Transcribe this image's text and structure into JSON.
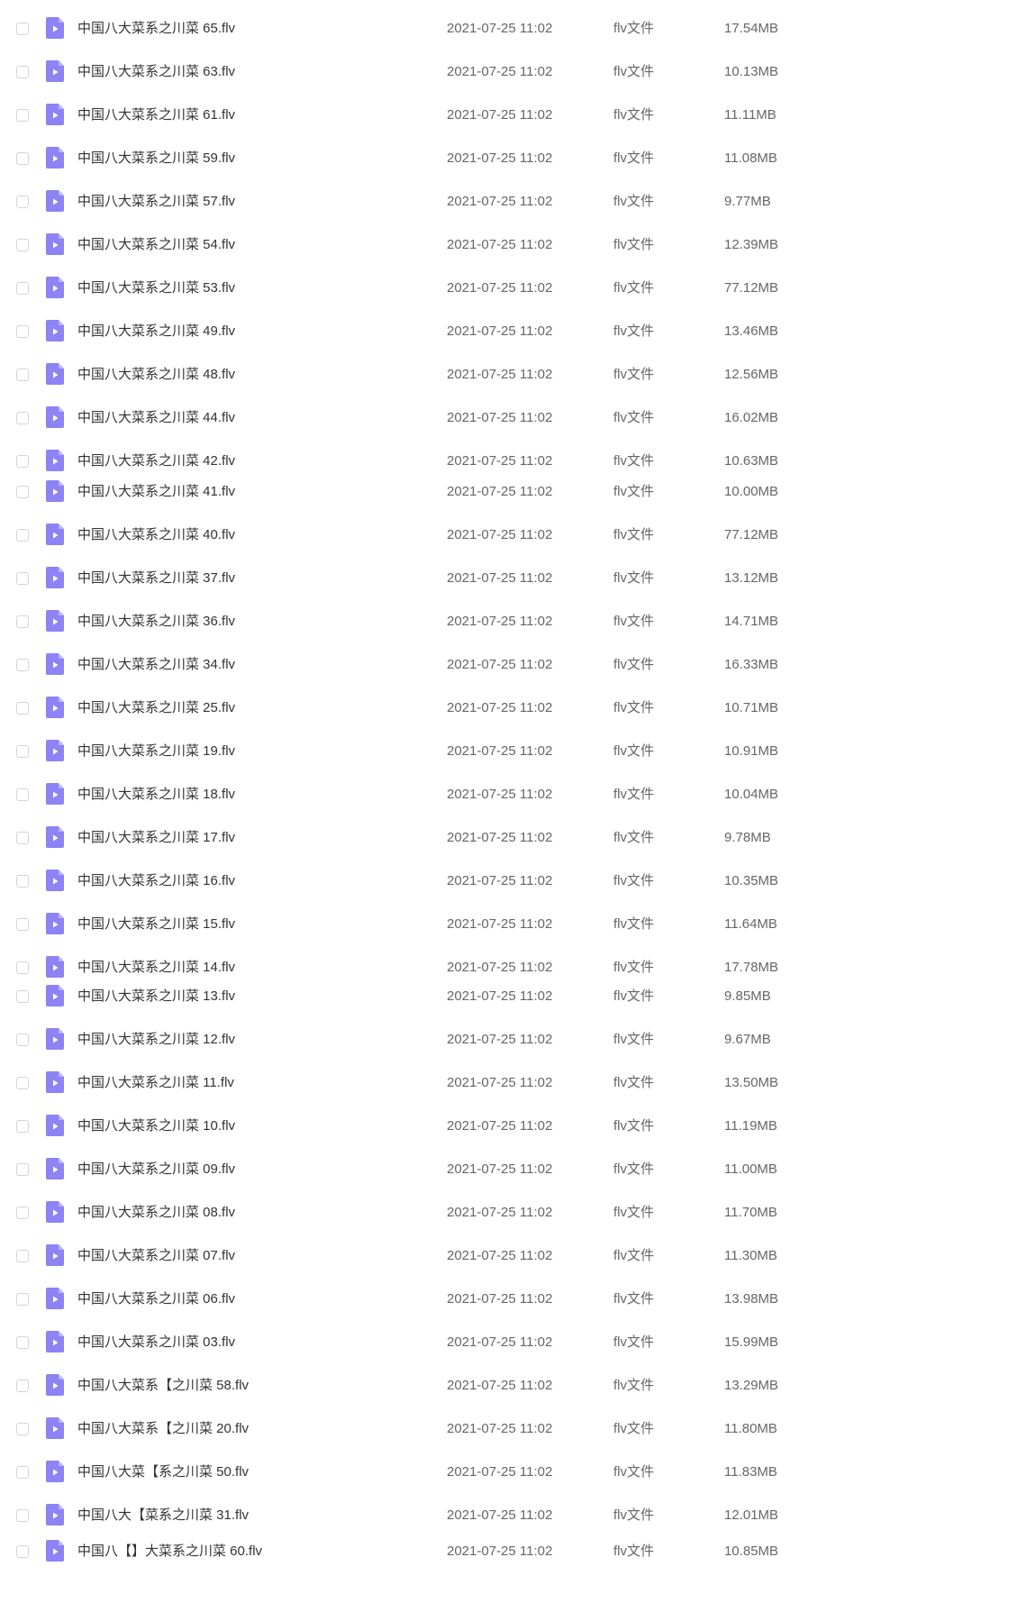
{
  "icon": "flv-video-file-icon",
  "colors": {
    "icon_purple": "#8c83f4",
    "icon_fold": "#b9b3fa",
    "checkbox_border": "#d4d4d4",
    "text_primary": "#333333",
    "text_secondary": "#666666"
  },
  "files": [
    {
      "name": "中国八大菜系之川菜 65.flv",
      "date": "2021-07-25 11:02",
      "type": "flv文件",
      "size": "17.54MB"
    },
    {
      "name": "中国八大菜系之川菜 63.flv",
      "date": "2021-07-25 11:02",
      "type": "flv文件",
      "size": "10.13MB"
    },
    {
      "name": "中国八大菜系之川菜 61.flv",
      "date": "2021-07-25 11:02",
      "type": "flv文件",
      "size": "11.11MB"
    },
    {
      "name": "中国八大菜系之川菜 59.flv",
      "date": "2021-07-25 11:02",
      "type": "flv文件",
      "size": "11.08MB"
    },
    {
      "name": "中国八大菜系之川菜 57.flv",
      "date": "2021-07-25 11:02",
      "type": "flv文件",
      "size": "9.77MB"
    },
    {
      "name": "中国八大菜系之川菜 54.flv",
      "date": "2021-07-25 11:02",
      "type": "flv文件",
      "size": "12.39MB"
    },
    {
      "name": "中国八大菜系之川菜 53.flv",
      "date": "2021-07-25 11:02",
      "type": "flv文件",
      "size": "77.12MB"
    },
    {
      "name": "中国八大菜系之川菜 49.flv",
      "date": "2021-07-25 11:02",
      "type": "flv文件",
      "size": "13.46MB"
    },
    {
      "name": "中国八大菜系之川菜 48.flv",
      "date": "2021-07-25 11:02",
      "type": "flv文件",
      "size": "12.56MB"
    },
    {
      "name": "中国八大菜系之川菜 44.flv",
      "date": "2021-07-25 11:02",
      "type": "flv文件",
      "size": "16.02MB"
    },
    {
      "name": "中国八大菜系之川菜 42.flv",
      "date": "2021-07-25 11:02",
      "type": "flv文件",
      "size": "10.63MB"
    },
    {
      "name": "中国八大菜系之川菜 41.flv",
      "date": "2021-07-25 11:02",
      "type": "flv文件",
      "size": "10.00MB"
    },
    {
      "name": "中国八大菜系之川菜 40.flv",
      "date": "2021-07-25 11:02",
      "type": "flv文件",
      "size": "77.12MB"
    },
    {
      "name": "中国八大菜系之川菜 37.flv",
      "date": "2021-07-25 11:02",
      "type": "flv文件",
      "size": "13.12MB"
    },
    {
      "name": "中国八大菜系之川菜 36.flv",
      "date": "2021-07-25 11:02",
      "type": "flv文件",
      "size": "14.71MB"
    },
    {
      "name": "中国八大菜系之川菜 34.flv",
      "date": "2021-07-25 11:02",
      "type": "flv文件",
      "size": "16.33MB"
    },
    {
      "name": "中国八大菜系之川菜 25.flv",
      "date": "2021-07-25 11:02",
      "type": "flv文件",
      "size": "10.71MB"
    },
    {
      "name": "中国八大菜系之川菜 19.flv",
      "date": "2021-07-25 11:02",
      "type": "flv文件",
      "size": "10.91MB"
    },
    {
      "name": "中国八大菜系之川菜 18.flv",
      "date": "2021-07-25 11:02",
      "type": "flv文件",
      "size": "10.04MB"
    },
    {
      "name": "中国八大菜系之川菜 17.flv",
      "date": "2021-07-25 11:02",
      "type": "flv文件",
      "size": "9.78MB"
    },
    {
      "name": "中国八大菜系之川菜 16.flv",
      "date": "2021-07-25 11:02",
      "type": "flv文件",
      "size": "10.35MB"
    },
    {
      "name": "中国八大菜系之川菜 15.flv",
      "date": "2021-07-25 11:02",
      "type": "flv文件",
      "size": "11.64MB"
    },
    {
      "name": "中国八大菜系之川菜 14.flv",
      "date": "2021-07-25 11:02",
      "type": "flv文件",
      "size": "17.78MB"
    },
    {
      "name": "中国八大菜系之川菜 13.flv",
      "date": "2021-07-25 11:02",
      "type": "flv文件",
      "size": "9.85MB"
    },
    {
      "name": "中国八大菜系之川菜 12.flv",
      "date": "2021-07-25 11:02",
      "type": "flv文件",
      "size": "9.67MB"
    },
    {
      "name": "中国八大菜系之川菜 11.flv",
      "date": "2021-07-25 11:02",
      "type": "flv文件",
      "size": "13.50MB"
    },
    {
      "name": "中国八大菜系之川菜 10.flv",
      "date": "2021-07-25 11:02",
      "type": "flv文件",
      "size": "11.19MB"
    },
    {
      "name": "中国八大菜系之川菜 09.flv",
      "date": "2021-07-25 11:02",
      "type": "flv文件",
      "size": "11.00MB"
    },
    {
      "name": "中国八大菜系之川菜 08.flv",
      "date": "2021-07-25 11:02",
      "type": "flv文件",
      "size": "11.70MB"
    },
    {
      "name": "中国八大菜系之川菜 07.flv",
      "date": "2021-07-25 11:02",
      "type": "flv文件",
      "size": "11.30MB"
    },
    {
      "name": "中国八大菜系之川菜 06.flv",
      "date": "2021-07-25 11:02",
      "type": "flv文件",
      "size": "13.98MB"
    },
    {
      "name": "中国八大菜系之川菜 03.flv",
      "date": "2021-07-25 11:02",
      "type": "flv文件",
      "size": "15.99MB"
    },
    {
      "name": "中国八大菜系【之川菜 58.flv",
      "date": "2021-07-25 11:02",
      "type": "flv文件",
      "size": "13.29MB"
    },
    {
      "name": "中国八大菜系【之川菜 20.flv",
      "date": "2021-07-25 11:02",
      "type": "flv文件",
      "size": "11.80MB"
    },
    {
      "name": "中国八大菜【系之川菜 50.flv",
      "date": "2021-07-25 11:02",
      "type": "flv文件",
      "size": "11.83MB"
    },
    {
      "name": "中国八大【菜系之川菜 31.flv",
      "date": "2021-07-25 11:02",
      "type": "flv文件",
      "size": "12.01MB"
    },
    {
      "name": "中国八【】大菜系之川菜 60.flv",
      "date": "2021-07-25 11:02",
      "type": "flv文件",
      "size": "10.85MB"
    }
  ]
}
